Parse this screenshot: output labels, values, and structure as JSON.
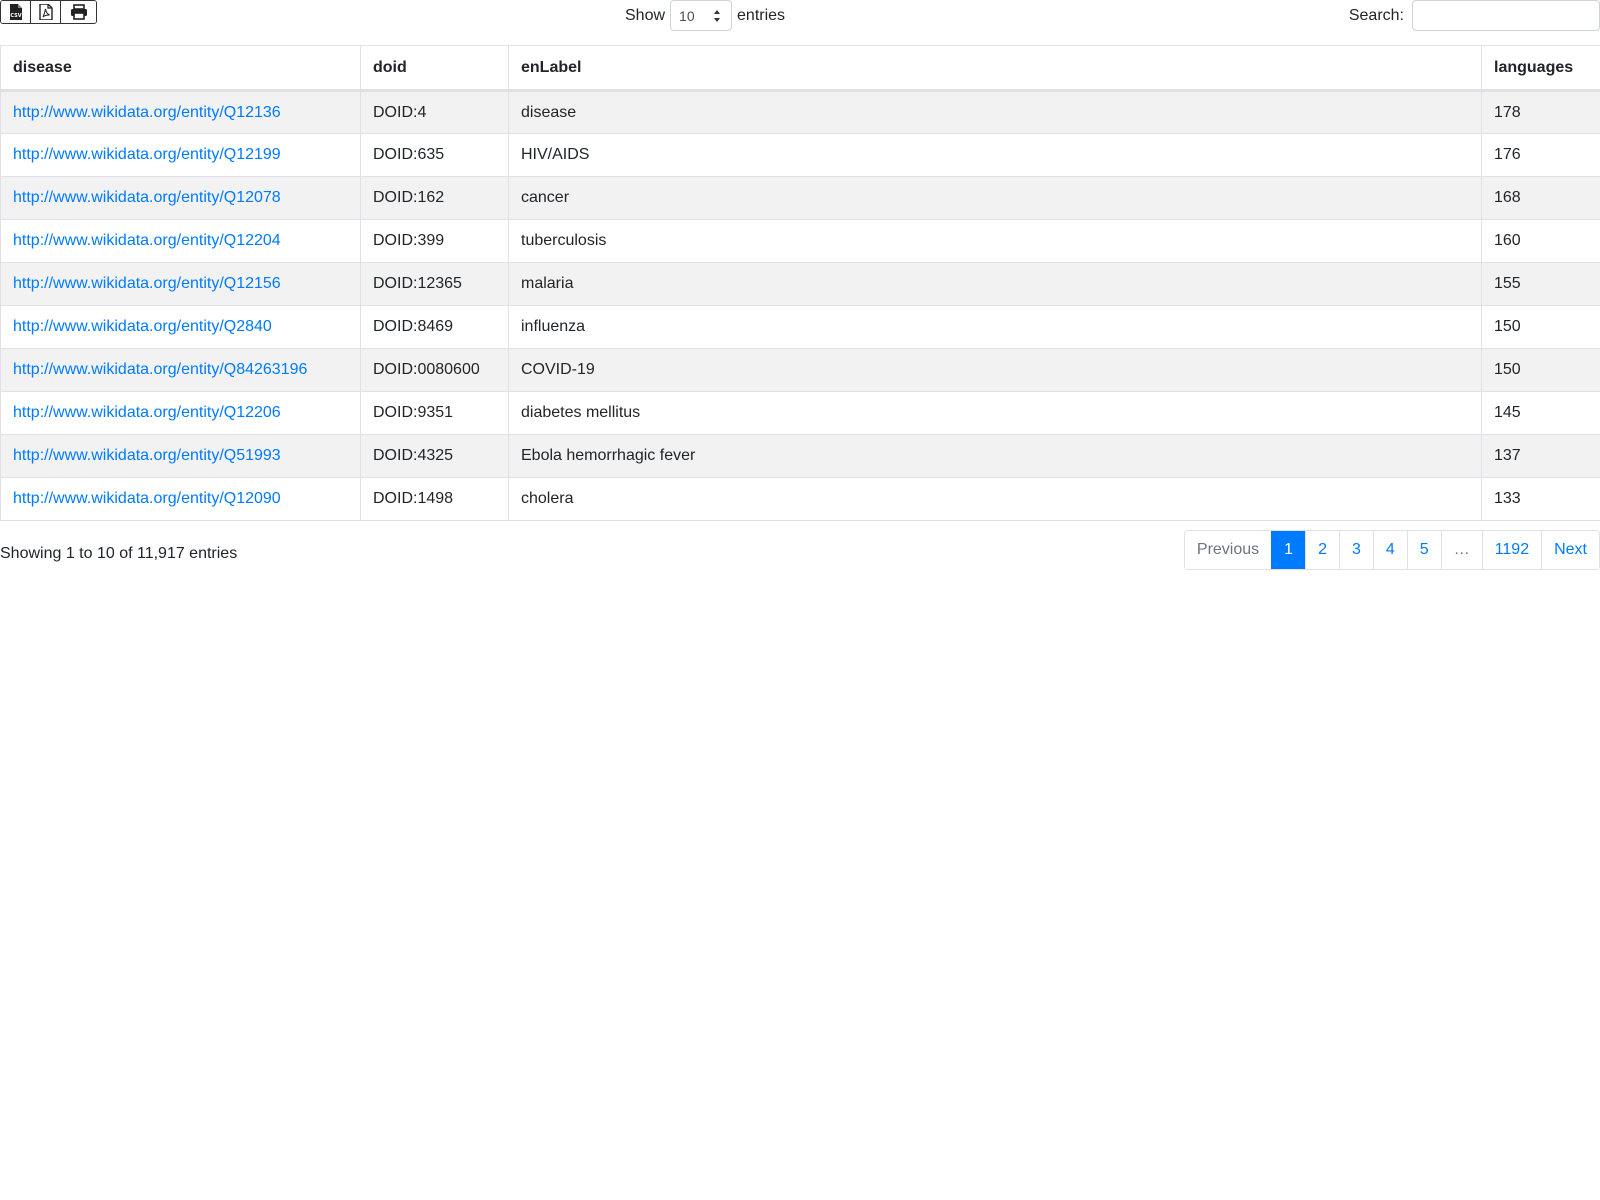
{
  "toolbar": {
    "export_buttons": [
      {
        "icon": "file-csv-icon",
        "label": "CSV"
      },
      {
        "icon": "file-pdf-icon"
      },
      {
        "icon": "print-icon"
      }
    ]
  },
  "length": {
    "prefix": "Show",
    "selected": "10",
    "suffix": "entries"
  },
  "search": {
    "label": "Search:",
    "value": "",
    "placeholder": ""
  },
  "table": {
    "columns": [
      "disease",
      "doid",
      "enLabel",
      "languages"
    ],
    "rows": [
      [
        "http://www.wikidata.org/entity/Q12136",
        "DOID:4",
        "disease",
        "178"
      ],
      [
        "http://www.wikidata.org/entity/Q12199",
        "DOID:635",
        "HIV/AIDS",
        "176"
      ],
      [
        "http://www.wikidata.org/entity/Q12078",
        "DOID:162",
        "cancer",
        "168"
      ],
      [
        "http://www.wikidata.org/entity/Q12204",
        "DOID:399",
        "tuberculosis",
        "160"
      ],
      [
        "http://www.wikidata.org/entity/Q12156",
        "DOID:12365",
        "malaria",
        "155"
      ],
      [
        "http://www.wikidata.org/entity/Q2840",
        "DOID:8469",
        "influenza",
        "150"
      ],
      [
        "http://www.wikidata.org/entity/Q84263196",
        "DOID:0080600",
        "COVID-19",
        "150"
      ],
      [
        "http://www.wikidata.org/entity/Q12206",
        "DOID:9351",
        "diabetes mellitus",
        "145"
      ],
      [
        "http://www.wikidata.org/entity/Q51993",
        "DOID:4325",
        "Ebola hemorrhagic fever",
        "137"
      ],
      [
        "http://www.wikidata.org/entity/Q12090",
        "DOID:1498",
        "cholera",
        "133"
      ]
    ]
  },
  "info": "Showing 1 to 10 of 11,917 entries",
  "pagination": {
    "previous": "Previous",
    "pages": [
      "1",
      "2",
      "3",
      "4",
      "5"
    ],
    "ellipsis": "…",
    "last": "1192",
    "next": "Next",
    "active": "1"
  },
  "colors": {
    "link": "#007bff",
    "stripe": "#f2f2f2",
    "border": "#dee2e6"
  }
}
